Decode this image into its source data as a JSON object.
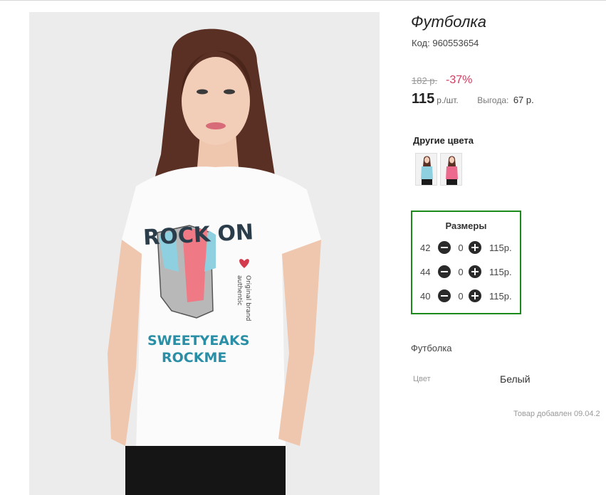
{
  "product": {
    "title": "Футболка",
    "code_label": "Код:",
    "code": "960553654",
    "old_price": "182 р.",
    "discount": "-37%",
    "price": "115",
    "price_unit": "р./шт.",
    "benefit_label": "Выгода:",
    "benefit_value": "67 р.",
    "description": "Футболка",
    "added_note": "Товар добавлен 09.04.2"
  },
  "photo": {
    "print_text_1": "ROCK ON",
    "print_text_2": "SWEETYEAKS",
    "print_text_3": "ROCKME",
    "print_side_1": "Original brand",
    "print_side_2": "authentic"
  },
  "other_colors": {
    "title": "Другие цвета",
    "swatches": [
      {
        "color": "#8fd0e0"
      },
      {
        "color": "#ec6a8e"
      }
    ]
  },
  "sizes": {
    "title": "Размеры",
    "rows": [
      {
        "size": "42",
        "qty": "0",
        "price": "115р."
      },
      {
        "size": "44",
        "qty": "0",
        "price": "115р."
      },
      {
        "size": "40",
        "qty": "0",
        "price": "115р."
      }
    ]
  },
  "attributes": {
    "color_label": "Цвет",
    "color_value": "Белый"
  },
  "colors": {
    "accent_discount": "#d33a5e",
    "sizes_border": "#1a8a1a"
  }
}
